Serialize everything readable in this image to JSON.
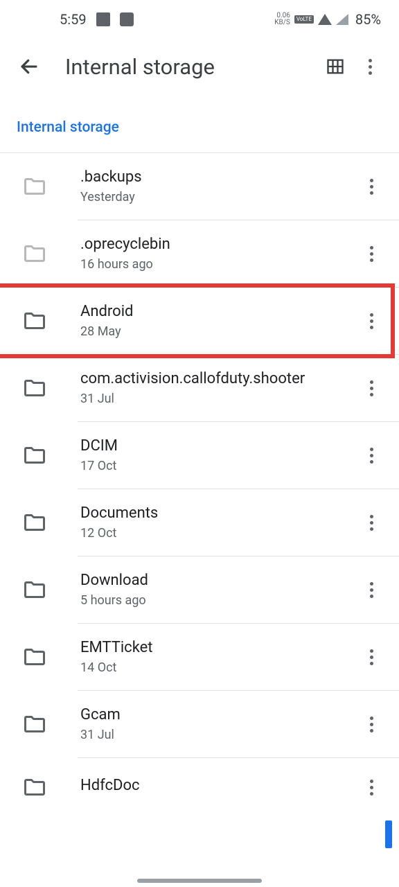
{
  "status": {
    "time": "5:59",
    "kbs_top": "0.06",
    "kbs_bottom": "KB/S",
    "volte": "VoLTE",
    "battery": "85%"
  },
  "header": {
    "title": "Internal storage"
  },
  "breadcrumb": "Internal storage",
  "folders": [
    {
      "name": ".backups",
      "sub": "Yesterday",
      "muted": true
    },
    {
      "name": ".oprecyclebin",
      "sub": "16 hours ago",
      "muted": true
    },
    {
      "name": "Android",
      "sub": "28 May",
      "muted": false
    },
    {
      "name": "com.activision.callofduty.shooter",
      "sub": "31 Jul",
      "muted": false
    },
    {
      "name": "DCIM",
      "sub": "17 Oct",
      "muted": false
    },
    {
      "name": "Documents",
      "sub": "12 Oct",
      "muted": false
    },
    {
      "name": "Download",
      "sub": "5 hours ago",
      "muted": false
    },
    {
      "name": "EMTTicket",
      "sub": "14 Oct",
      "muted": false
    },
    {
      "name": "Gcam",
      "sub": "31 Jul",
      "muted": false
    },
    {
      "name": "HdfcDoc",
      "sub": "",
      "muted": false
    }
  ],
  "highlight_index": 2
}
